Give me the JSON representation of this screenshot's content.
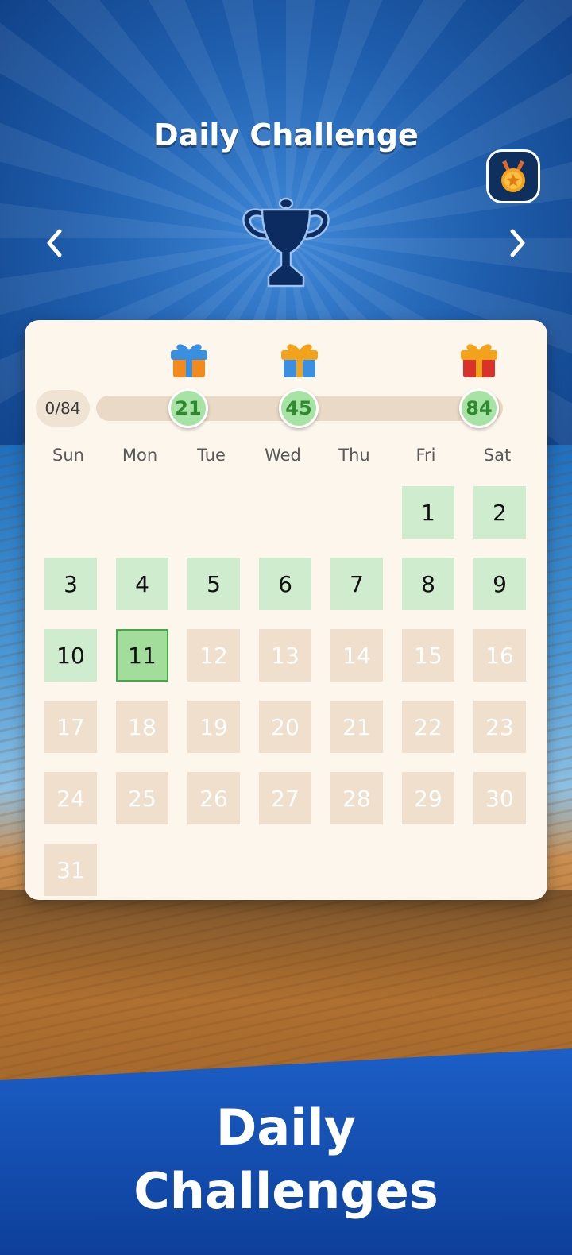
{
  "header": {
    "title": "Daily Challenge",
    "medal_icon": "medal-icon",
    "prev_icon": "chevron-left-icon",
    "next_icon": "chevron-right-icon",
    "trophy_icon": "trophy-silhouette-icon"
  },
  "progress": {
    "label": "0/84",
    "current": 0,
    "total": 84,
    "milestones": [
      {
        "value": "21",
        "gift": "blue-gift-icon"
      },
      {
        "value": "45",
        "gift": "orange-gift-icon"
      },
      {
        "value": "84",
        "gift": "red-gift-icon"
      }
    ]
  },
  "calendar": {
    "weekdays": [
      "Sun",
      "Mon",
      "Tue",
      "Wed",
      "Thu",
      "Fri",
      "Sat"
    ],
    "first_weekday_index": 5,
    "days_in_month": 31,
    "completed_days": [
      1,
      2,
      3,
      4,
      5,
      6,
      7,
      8,
      9,
      10
    ],
    "today": 11
  },
  "promo": {
    "line1": "Daily",
    "line2": "Challenges"
  },
  "colors": {
    "completed": "#cfeccf",
    "today": "#a3dd9b",
    "locked": "#efdfcc",
    "milestone": "#a7e3a4",
    "card": "#fdf6ec"
  }
}
